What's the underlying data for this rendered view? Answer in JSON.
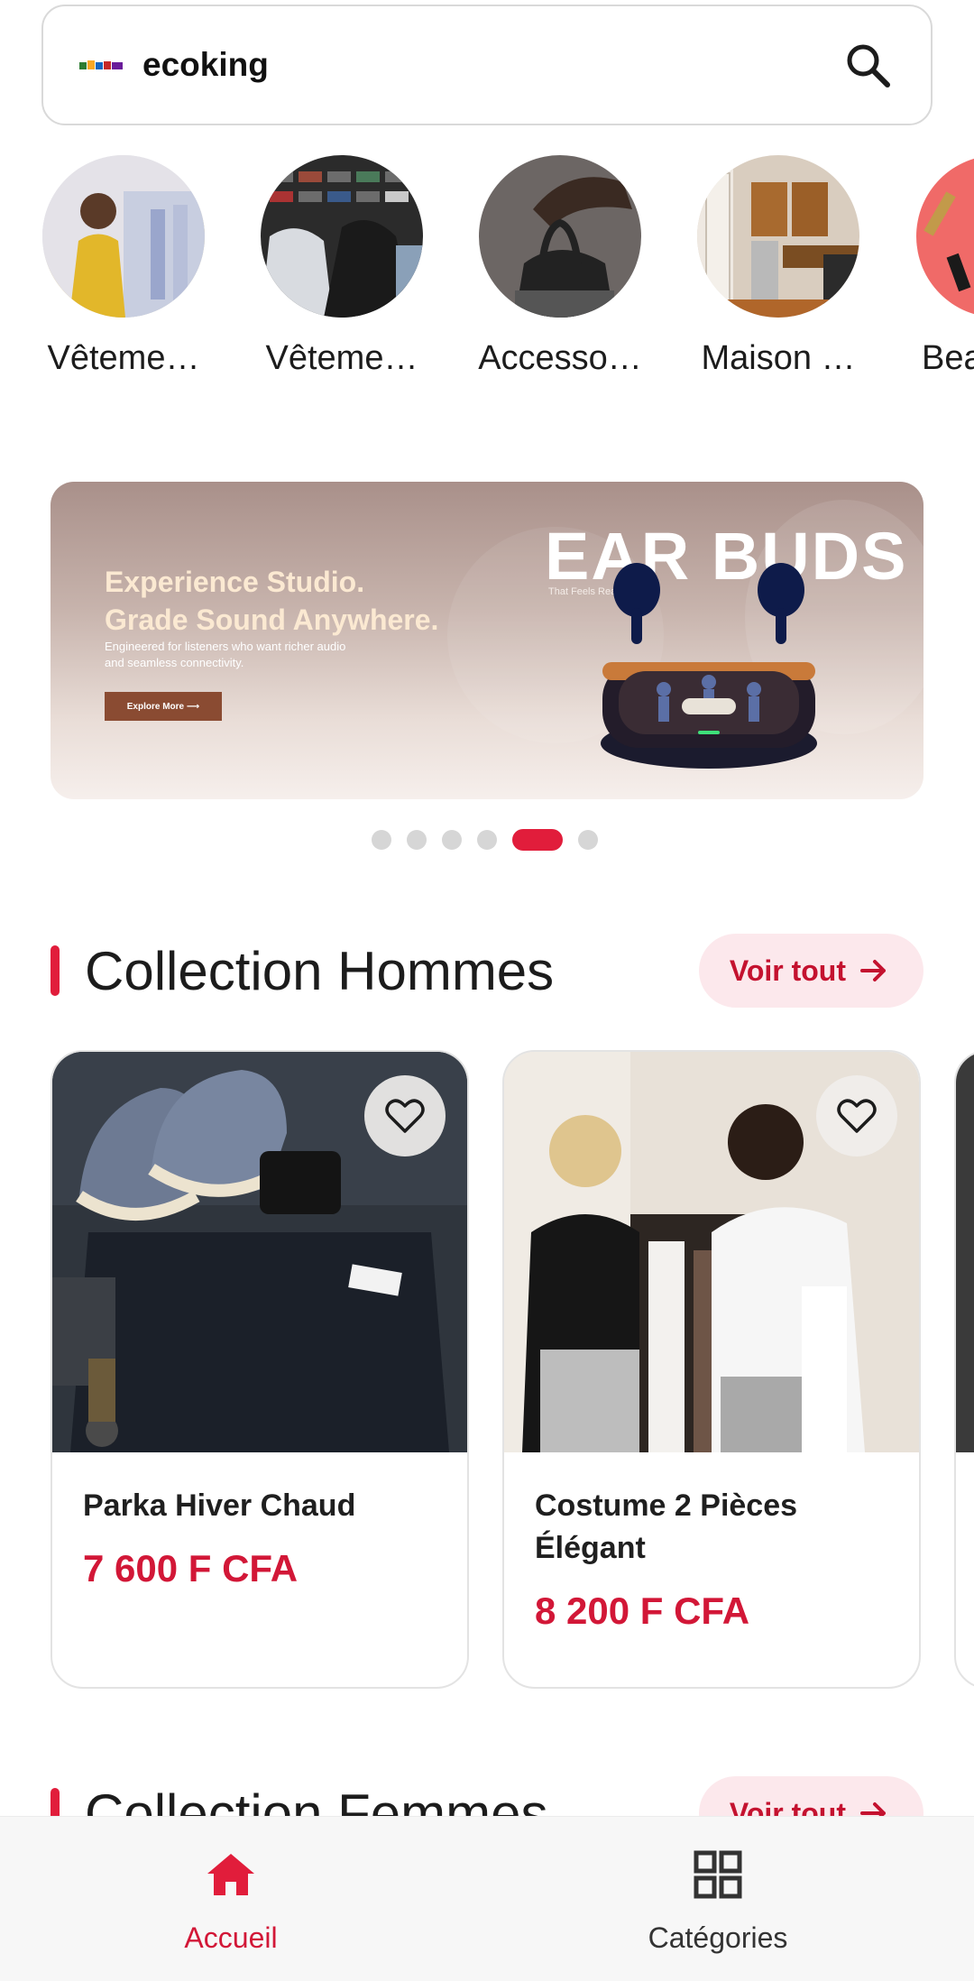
{
  "search": {
    "brand": "ecoking"
  },
  "categories": [
    {
      "label": "Vêteme…"
    },
    {
      "label": "Vêteme…"
    },
    {
      "label": "Accesso…"
    },
    {
      "label": "Maison …"
    },
    {
      "label": "Bea"
    }
  ],
  "banner": {
    "headline_1": "Experience Studio.",
    "headline_2": "Grade Sound Anywhere.",
    "subtext_1": "Engineered for listeners who want richer audio",
    "subtext_2": "and seamless connectivity.",
    "button": "Explore More ⟶",
    "brand": "EAR BUDS",
    "tagline": "That Feels Real"
  },
  "carousel": {
    "total": 6,
    "active_index": 5
  },
  "sections": [
    {
      "title": "Collection Hommes",
      "see_all": "Voir tout"
    },
    {
      "title": "Collection Femmes",
      "see_all": "Voir tout"
    }
  ],
  "products": [
    {
      "name": "Parka Hiver Chaud",
      "price": "7 600 F CFA"
    },
    {
      "name": "Costume 2 Pièces Élégant",
      "price": "8 200 F CFA"
    }
  ],
  "nav": {
    "home": "Accueil",
    "categories": "Catégories"
  },
  "colors": {
    "accent": "#e11d3b",
    "price": "#d21737",
    "pill_bg": "#fce8ec"
  }
}
